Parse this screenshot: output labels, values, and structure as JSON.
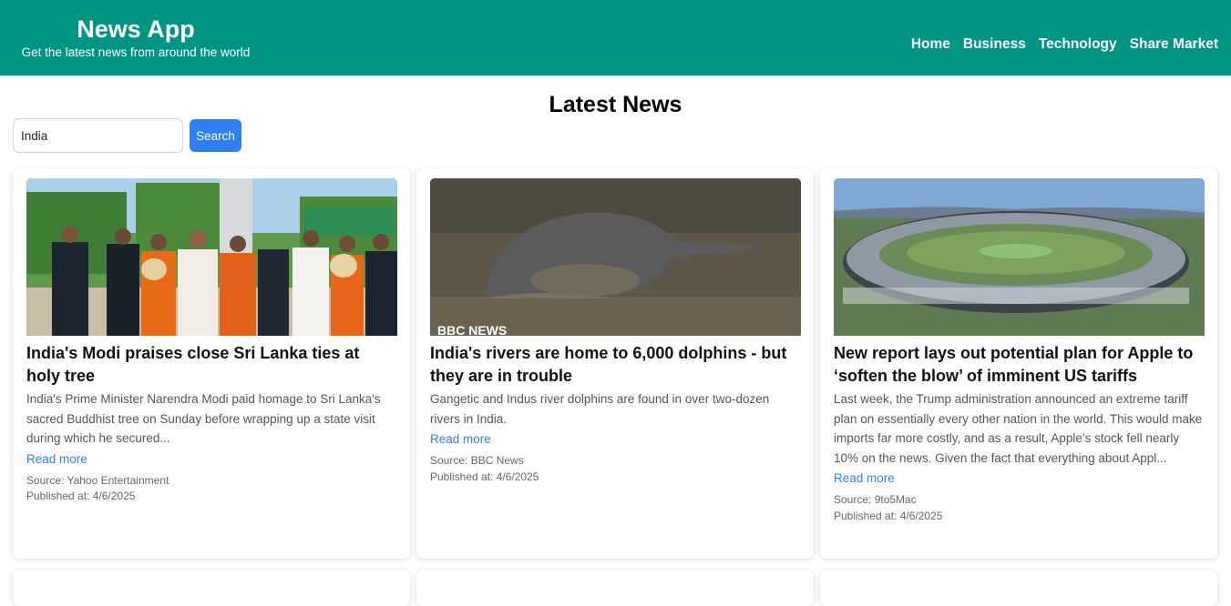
{
  "header": {
    "title": "News App",
    "tagline": "Get the latest news from around the world",
    "nav": [
      "Home",
      "Business",
      "Technology",
      "Share Market"
    ]
  },
  "page": {
    "heading": "Latest News"
  },
  "search": {
    "value": "India",
    "button_label": "Search"
  },
  "articles": [
    {
      "title": "India's Modi praises close Sri Lanka ties at holy tree",
      "description": "India's Prime Minister Narendra Modi paid homage to Sri Lanka's sacred Buddhist tree on Sunday before wrapping up a state visit during which he secured...",
      "read_more": "Read more",
      "source": "Source: Yahoo Entertainment",
      "published": "Published at: 4/6/2025"
    },
    {
      "title": "India's rivers are home to 6,000 dolphins - but they are in trouble",
      "description": "Gangetic and Indus river dolphins are found in over two-dozen rivers in India.",
      "read_more": "Read more",
      "source": "Source: BBC News",
      "published": "Published at: 4/6/2025",
      "image_watermark": "BBC NEWS"
    },
    {
      "title": "New report lays out potential plan for Apple to ‘soften the blow’ of imminent US tariffs",
      "description": "Last week, the Trump administration announced an extreme tariff plan on essentially every other nation in the world. This would make imports far more costly, and as a result, Apple’s stock fell nearly 10% on the news. Given the fact that everything about Appl...",
      "read_more": "Read more",
      "source": "Source: 9to5Mac",
      "published": "Published at: 4/6/2025"
    }
  ],
  "colors": {
    "header": "#009485",
    "accent": "#2f7ff3"
  }
}
